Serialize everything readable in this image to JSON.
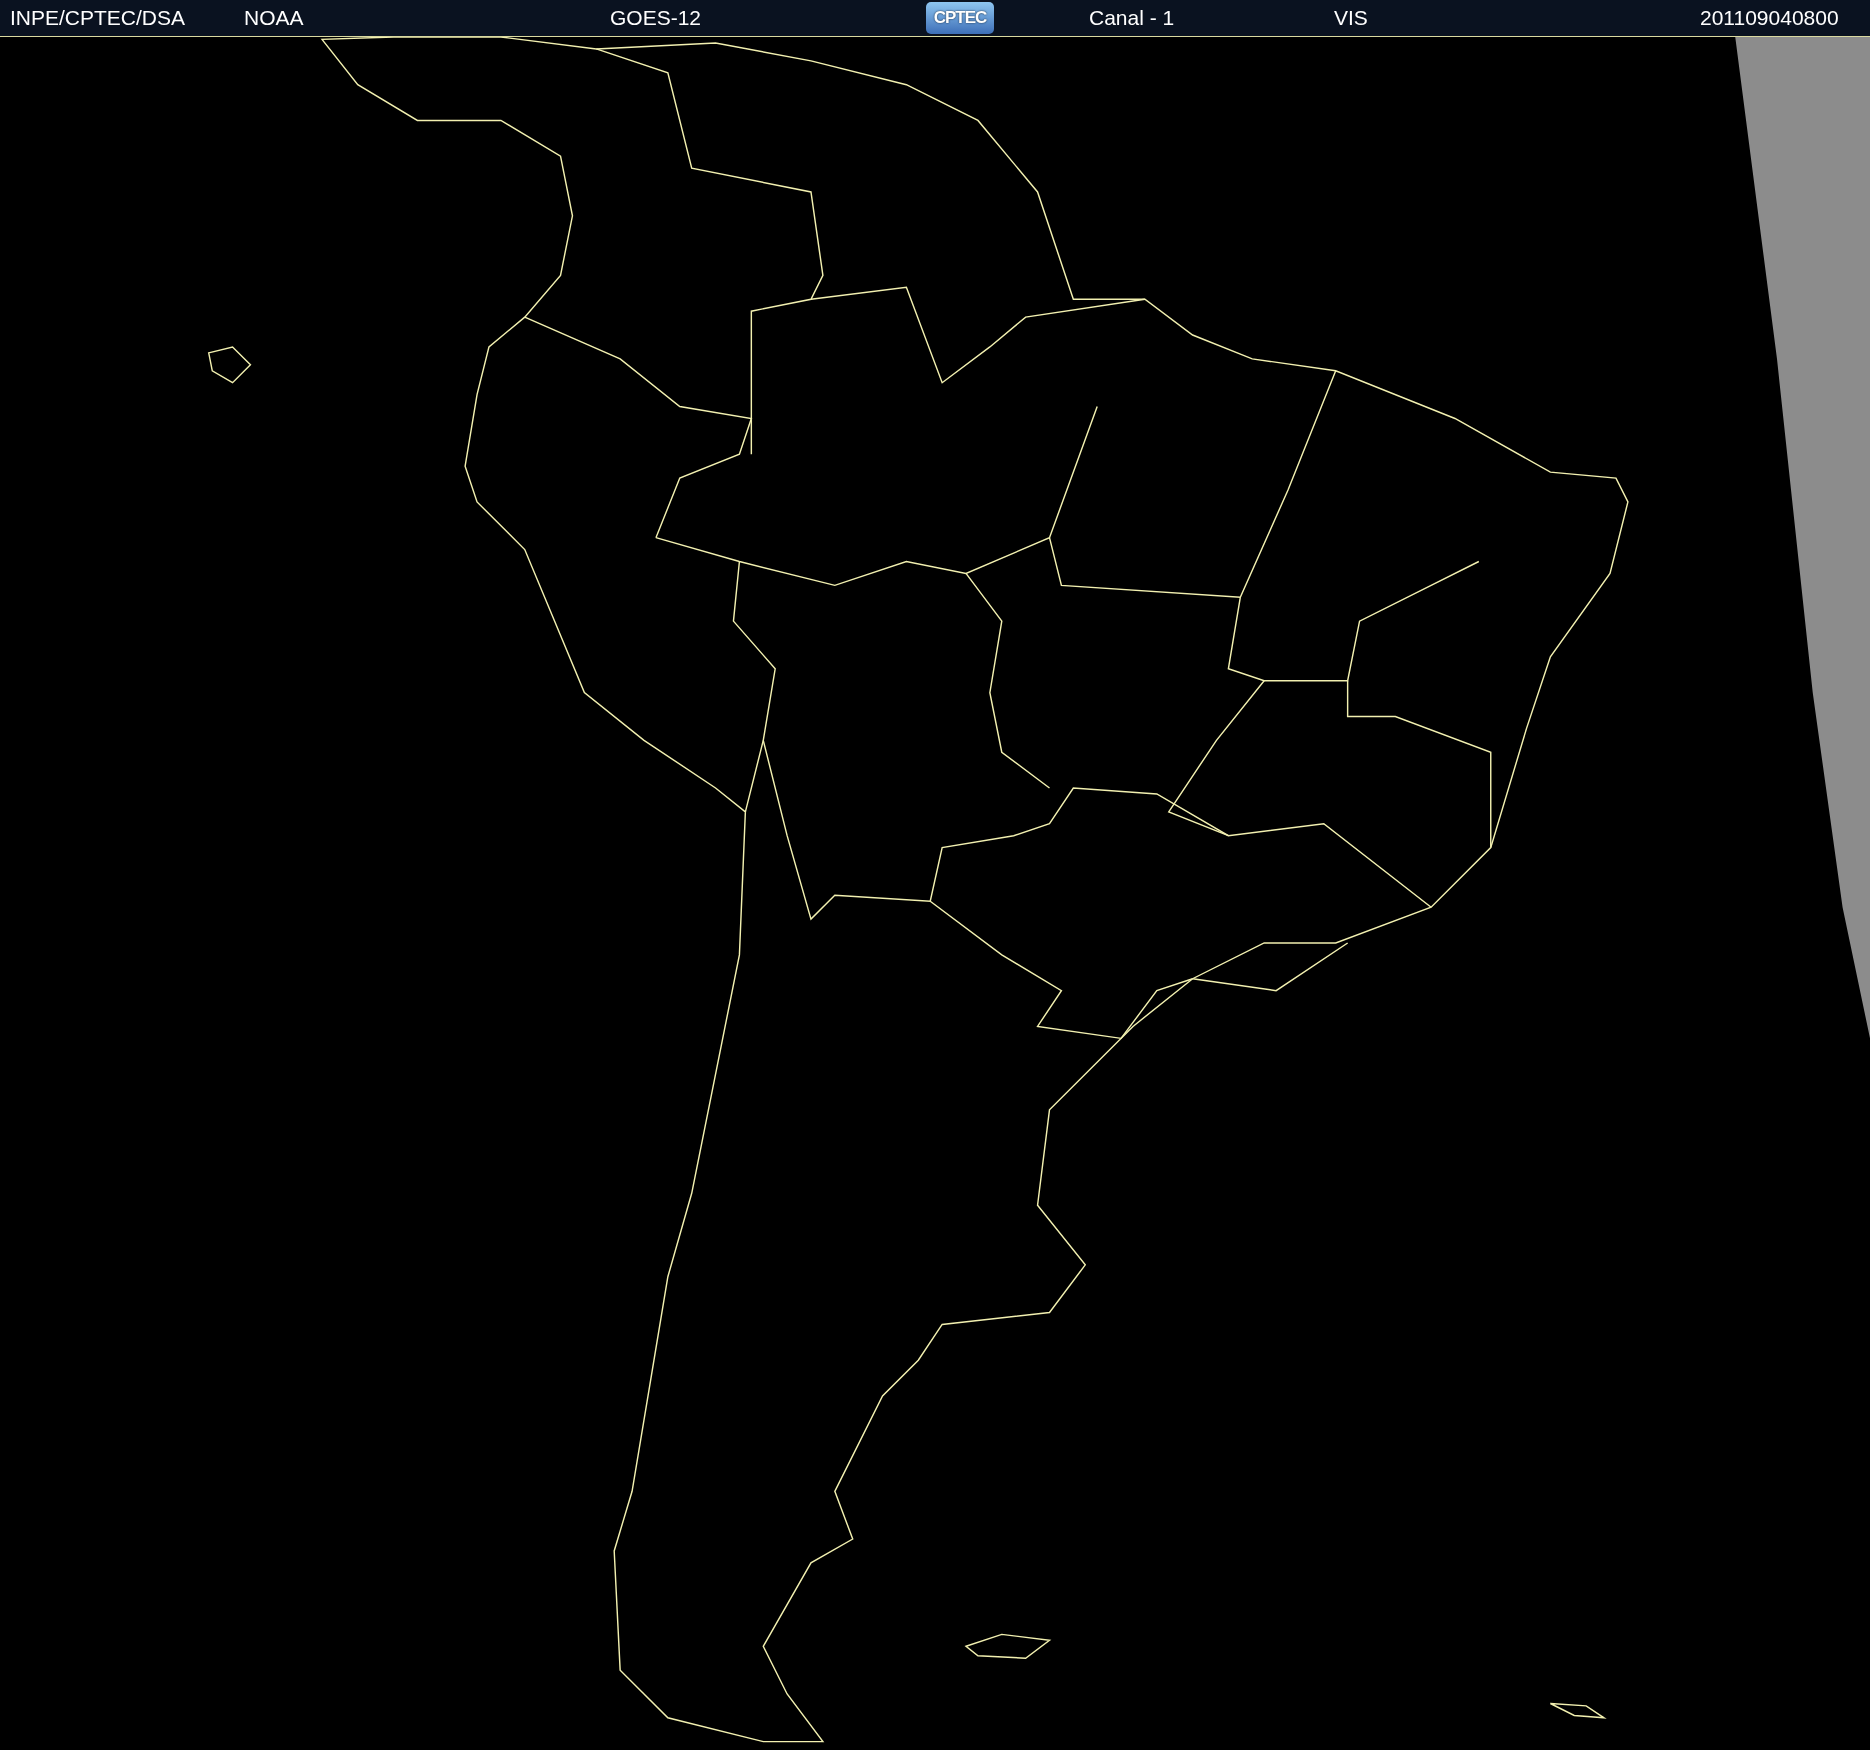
{
  "header": {
    "agency": "INPE/CPTEC/DSA",
    "source": "NOAA",
    "satellite": "GOES-12",
    "logo": "CPTEC",
    "channel": "Canal - 1",
    "band": "VIS",
    "timestamp": "201109040800"
  }
}
